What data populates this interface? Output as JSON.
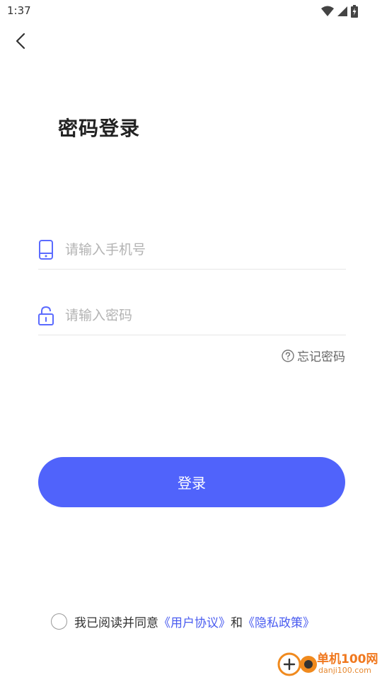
{
  "status_bar": {
    "time": "1:37"
  },
  "page": {
    "title": "密码登录"
  },
  "phone_field": {
    "placeholder": "请输入手机号",
    "value": ""
  },
  "password_field": {
    "placeholder": "请输入密码",
    "value": ""
  },
  "forgot": {
    "label": "忘记密码"
  },
  "login_button": {
    "label": "登录"
  },
  "agreement": {
    "prefix": "我已阅读并同意",
    "user_agreement": "《用户协议》",
    "and": "和",
    "privacy_policy": "《隐私政策》",
    "checked": false
  },
  "watermark": {
    "brand": "单机100网",
    "url": "danji100.com"
  },
  "colors": {
    "accent": "#5063fb",
    "link": "#4a5cf0",
    "icon": "#5b6bff"
  },
  "icons": [
    "back-arrow-icon",
    "wifi-icon",
    "signal-icon",
    "battery-icon",
    "phone-icon",
    "lock-icon",
    "question-circle-icon"
  ]
}
